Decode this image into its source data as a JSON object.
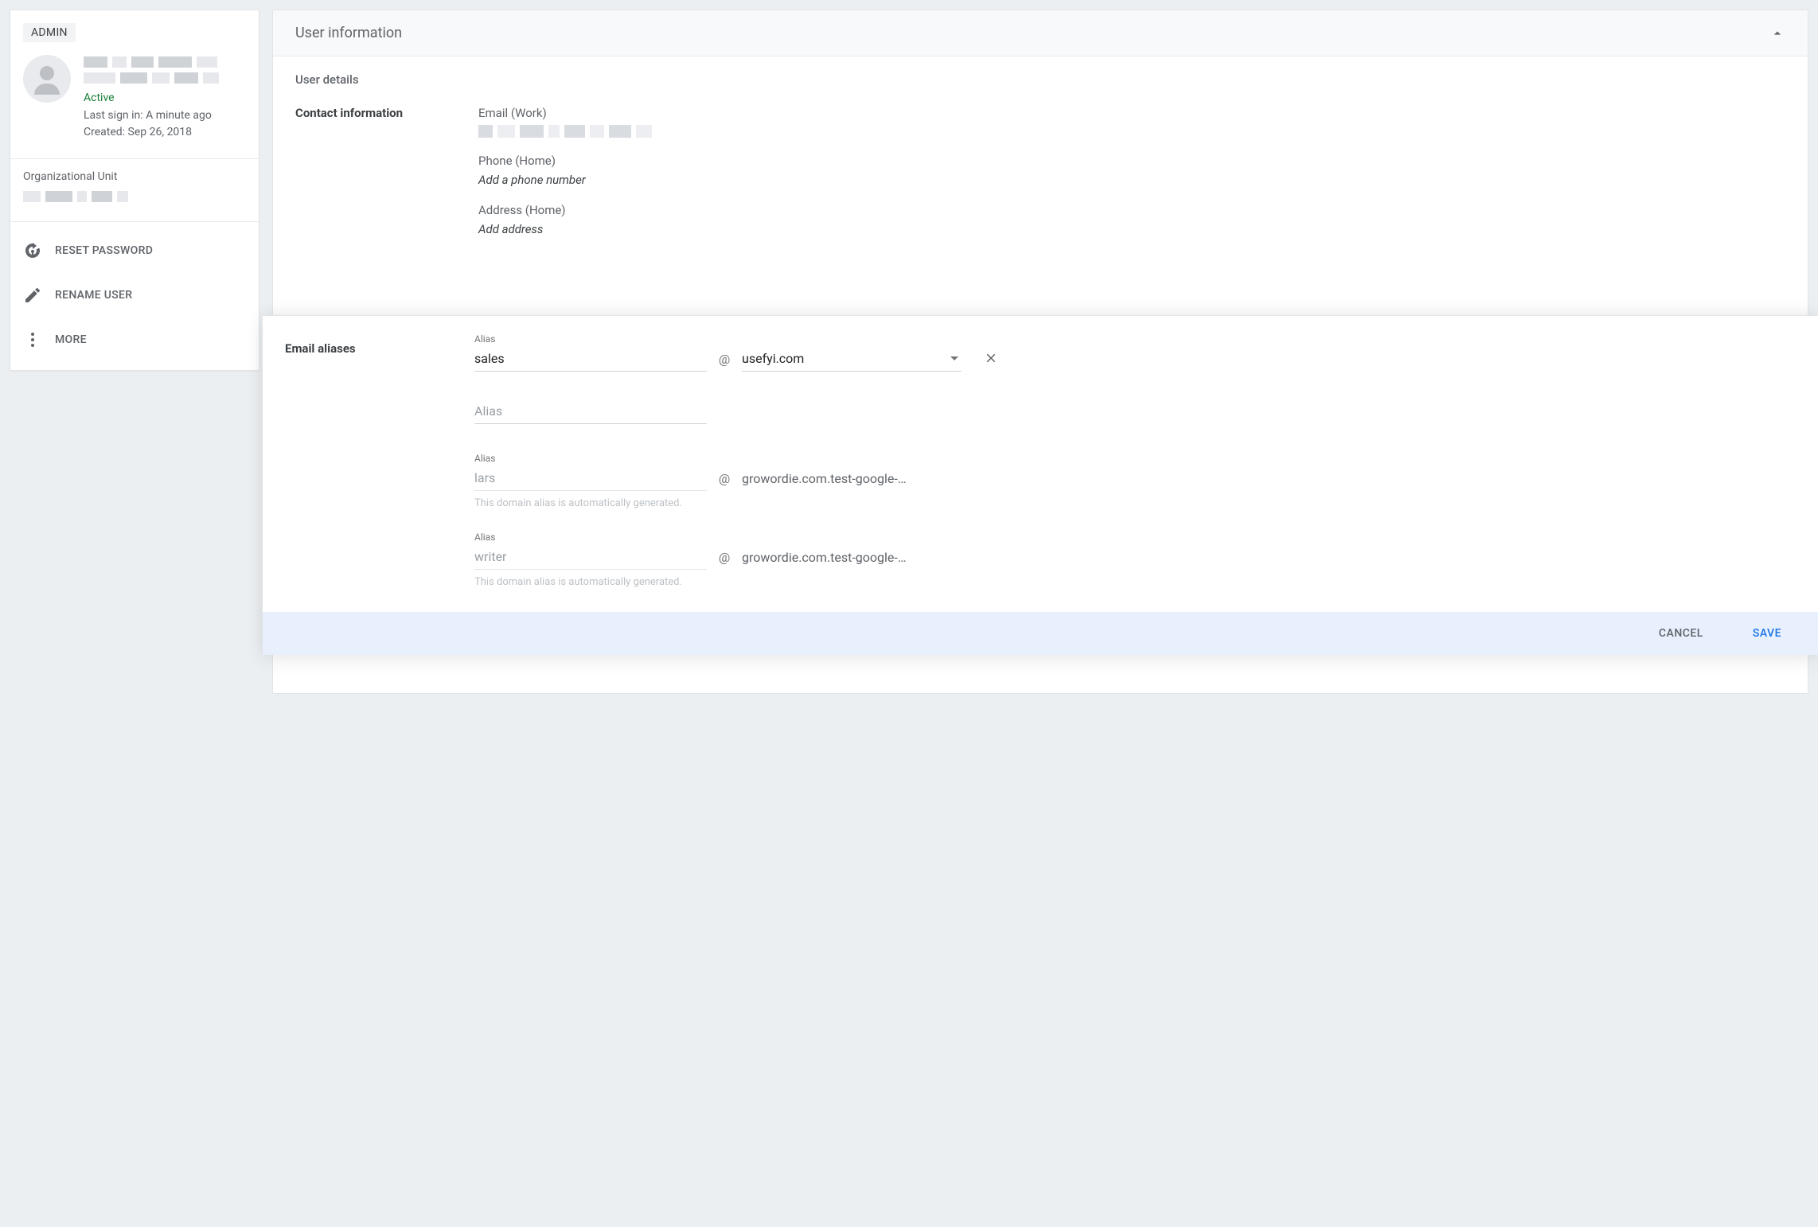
{
  "sidebar": {
    "role_chip": "ADMIN",
    "status": "Active",
    "last_signin": "Last sign in: A minute ago",
    "created": "Created: Sep 26, 2018",
    "org_unit_label": "Organizational Unit",
    "actions": {
      "reset_password": "RESET PASSWORD",
      "rename_user": "RENAME USER",
      "more": "MORE"
    }
  },
  "panel": {
    "title": "User information",
    "user_details_label": "User details",
    "contact": {
      "section_label": "Contact information",
      "email_label": "Email (Work)",
      "phone_label": "Phone (Home)",
      "phone_placeholder": "Add a phone number",
      "address_label": "Address (Home)",
      "address_placeholder": "Add address"
    }
  },
  "aliases": {
    "section_label": "Email aliases",
    "alias_field_label": "Alias",
    "alias_input_placeholder": "Alias",
    "auto_note": "This domain alias is automatically generated.",
    "rows": [
      {
        "value": "sales",
        "domain": "usefyi.com",
        "editable": true,
        "removable": true
      },
      {
        "value": "",
        "domain": "",
        "editable": true,
        "removable": false
      },
      {
        "value": "lars",
        "domain": "growordie.com.test-google-…",
        "editable": false,
        "removable": false
      },
      {
        "value": "writer",
        "domain": "growordie.com.test-google-…",
        "editable": false,
        "removable": false
      }
    ],
    "at_sign": "@",
    "cancel_label": "CANCEL",
    "save_label": "SAVE"
  }
}
